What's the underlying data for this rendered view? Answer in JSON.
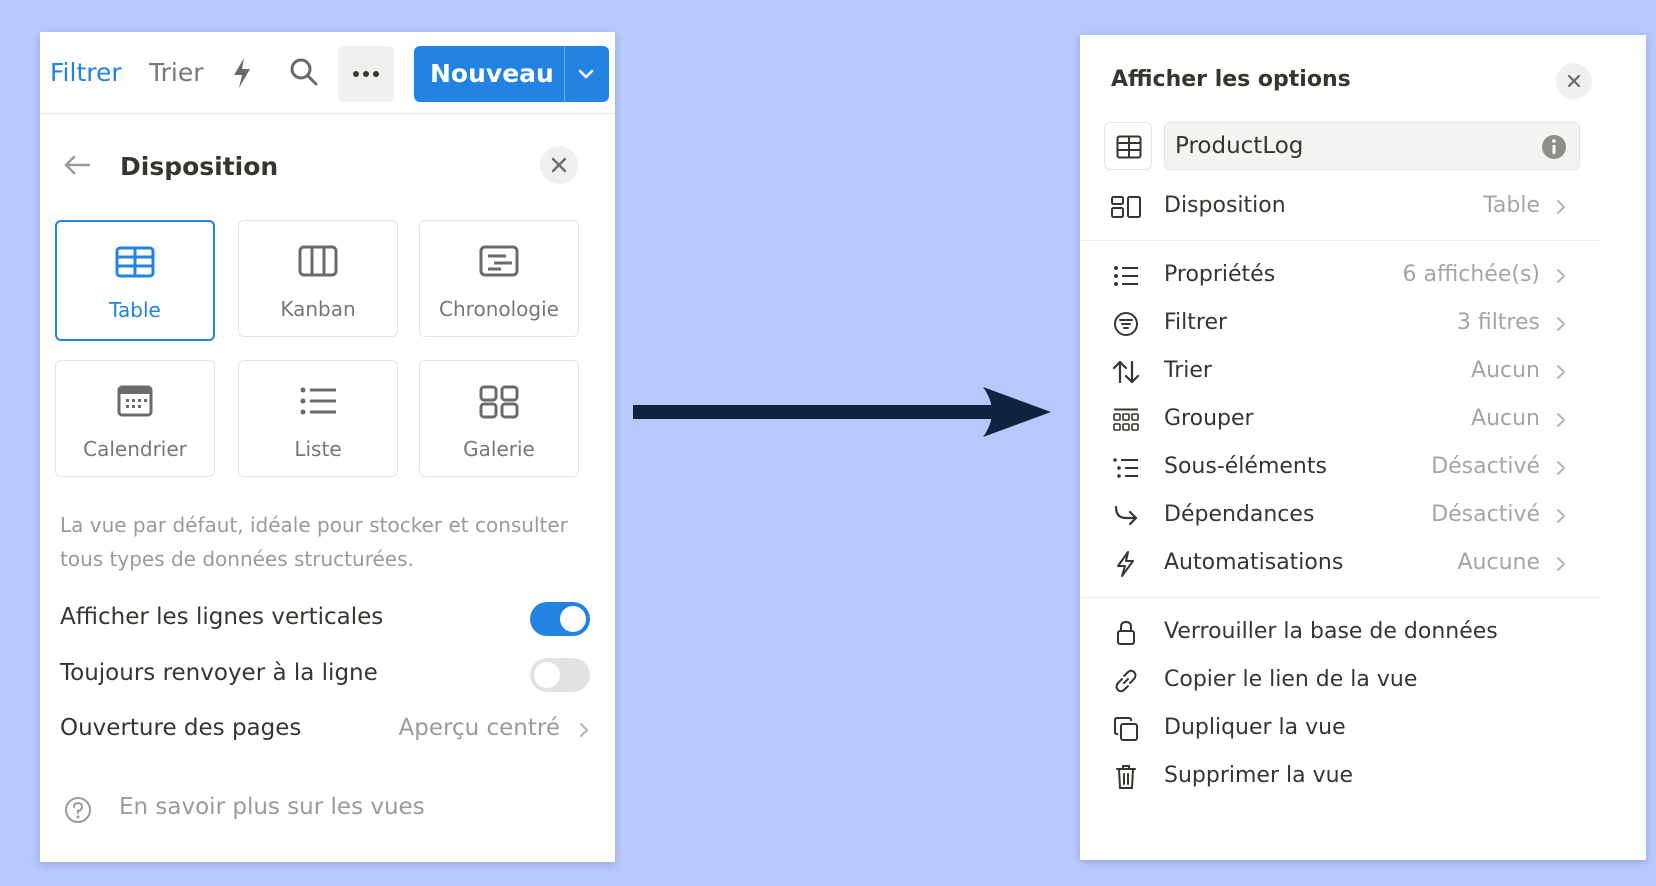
{
  "left_panel": {
    "toolbar": {
      "filter_label": "Filtrer",
      "sort_label": "Trier",
      "automation_icon": "lightning-icon",
      "search_icon": "search-icon",
      "more_icon": "ellipsis-icon",
      "new_label": "Nouveau",
      "new_dropdown_icon": "chevron-down-icon",
      "accent_color": "#2383e2"
    },
    "layout": {
      "title": "Disposition",
      "back_icon": "arrow-left-icon",
      "close_icon": "close-icon",
      "options": [
        {
          "label": "Table",
          "icon": "table-icon",
          "selected": true
        },
        {
          "label": "Kanban",
          "icon": "board-icon",
          "selected": false
        },
        {
          "label": "Chronologie",
          "icon": "timeline-icon",
          "selected": false
        },
        {
          "label": "Calendrier",
          "icon": "calendar-icon",
          "selected": false
        },
        {
          "label": "Liste",
          "icon": "list-icon",
          "selected": false
        },
        {
          "label": "Galerie",
          "icon": "gallery-icon",
          "selected": false
        }
      ],
      "description": "La vue par défaut, idéale pour stocker et consulter tous types de données structurées.",
      "settings": [
        {
          "label": "Afficher les lignes verticales",
          "enabled": true
        },
        {
          "label": "Toujours renvoyer à la ligne",
          "enabled": false
        }
      ],
      "page_open": {
        "label": "Ouverture des pages",
        "value": "Aperçu centré"
      },
      "learn_more": "En savoir plus sur les vues"
    }
  },
  "right_panel": {
    "title": "Afficher les options",
    "close_icon": "close-icon",
    "database_icon": "table-icon",
    "database_name": "ProductLog",
    "info_icon": "info-icon",
    "layout_row": {
      "label": "Disposition",
      "value": "Table",
      "icon": "layout-icon"
    },
    "settings_rows": [
      {
        "label": "Propriétés",
        "value": "6 affichée(s)",
        "icon": "list-icon"
      },
      {
        "label": "Filtrer",
        "value": "3 filtres",
        "icon": "filter-icon"
      },
      {
        "label": "Trier",
        "value": "Aucun",
        "icon": "sort-icon"
      },
      {
        "label": "Grouper",
        "value": "Aucun",
        "icon": "group-icon"
      },
      {
        "label": "Sous-éléments",
        "value": "Désactivé",
        "icon": "sub-items-icon"
      },
      {
        "label": "Dépendances",
        "value": "Désactivé",
        "icon": "dependency-icon"
      },
      {
        "label": "Automatisations",
        "value": "Aucune",
        "icon": "lightning-icon"
      }
    ],
    "action_rows": [
      {
        "label": "Verrouiller la base de données",
        "icon": "lock-icon"
      },
      {
        "label": "Copier le lien de la vue",
        "icon": "link-icon"
      },
      {
        "label": "Dupliquer la vue",
        "icon": "duplicate-icon"
      },
      {
        "label": "Supprimer la vue",
        "icon": "trash-icon"
      }
    ]
  },
  "flow_arrow_icon": "arrow-right-icon",
  "background_color": "#b8c8fb"
}
